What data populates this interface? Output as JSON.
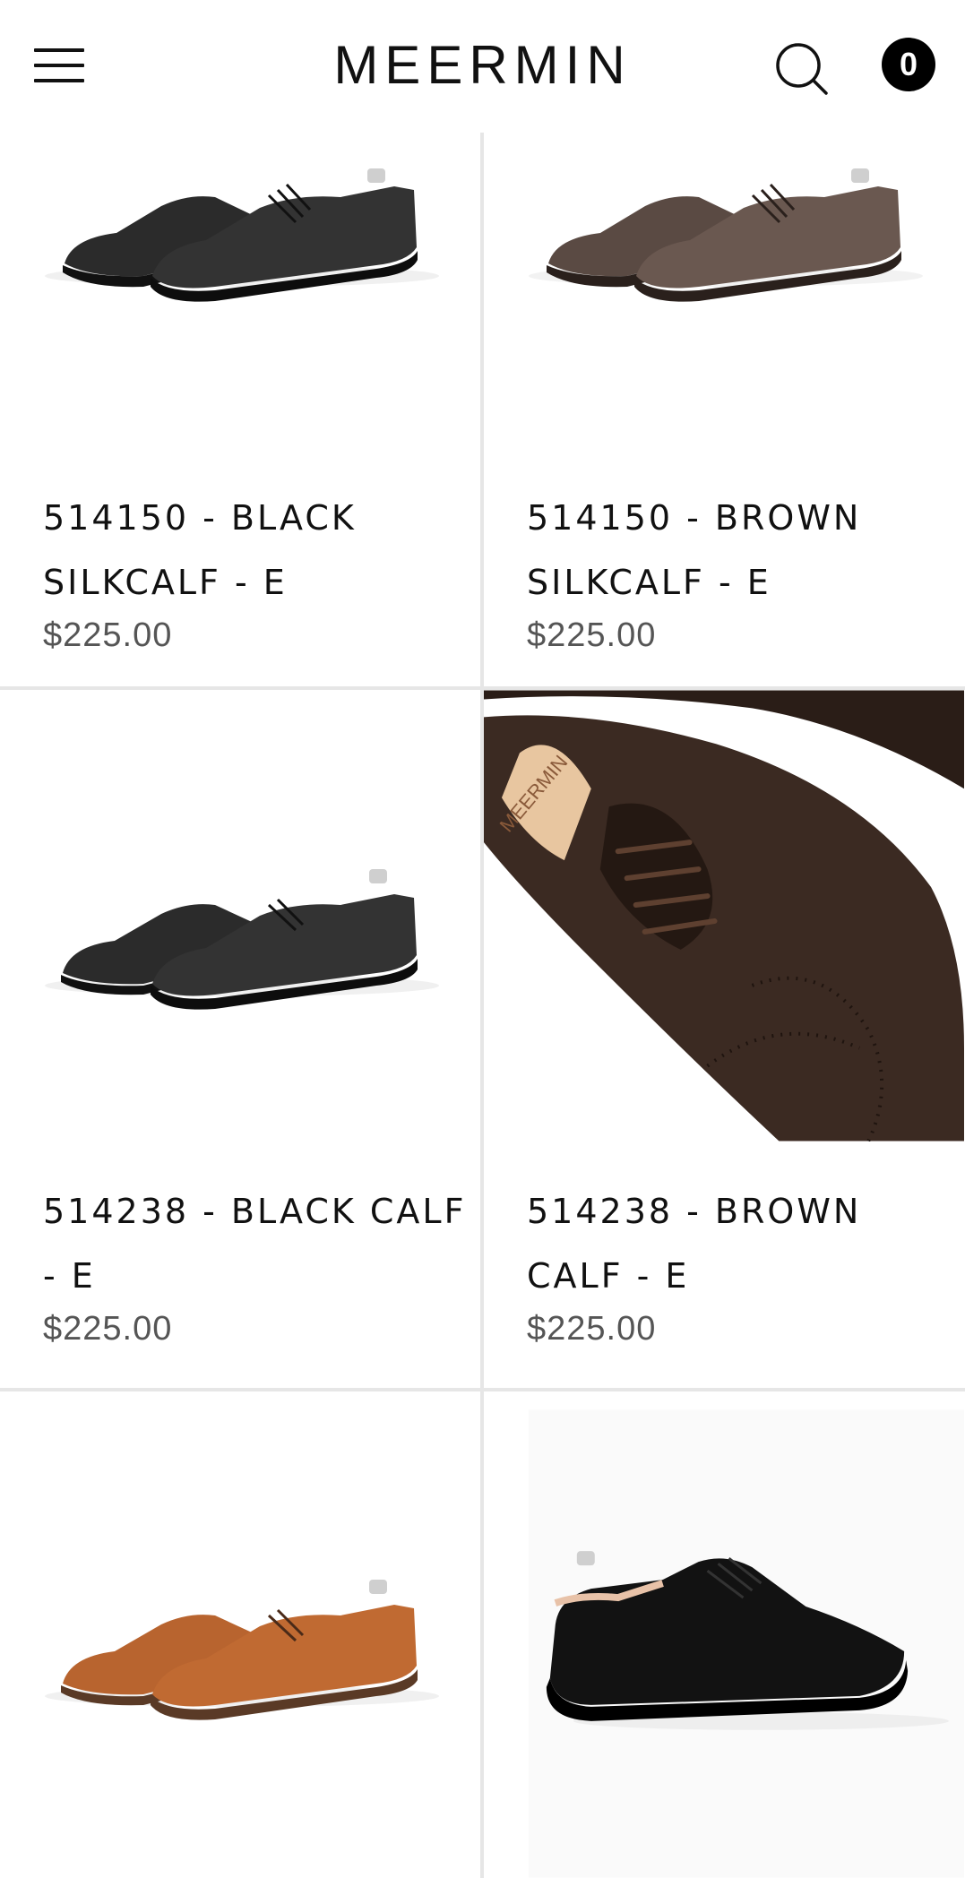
{
  "header": {
    "menu_icon": "hamburger-menu-icon",
    "logo": "MEERMIN",
    "search_icon": "search-icon",
    "cart_count": "0"
  },
  "products": [
    {
      "title": "514150 - BLACK SILKCALF - E",
      "price": "$225.00",
      "color": "#1e1e1e",
      "image_icon": "black-oxford-pair"
    },
    {
      "title": "514150 - BROWN SILKCALF - E",
      "price": "$225.00",
      "color": "#4a3b34",
      "image_icon": "brown-oxford-pair"
    },
    {
      "title": "514238 - BLACK CALF - E",
      "price": "$225.00",
      "color": "#1e1e1e",
      "image_icon": "black-brogue-pair"
    },
    {
      "title": "514238 - BROWN CALF - E",
      "price": "$225.00",
      "color": "#3d2a22",
      "image_icon": "brown-brogue-closeup",
      "tree_brand": "MEERMIN"
    },
    {
      "title": "",
      "price": "",
      "color": "#a4542a",
      "image_icon": "tan-brogue-pair"
    },
    {
      "title": "",
      "price": "",
      "color": "#111111",
      "image_icon": "black-oxford-single"
    }
  ]
}
